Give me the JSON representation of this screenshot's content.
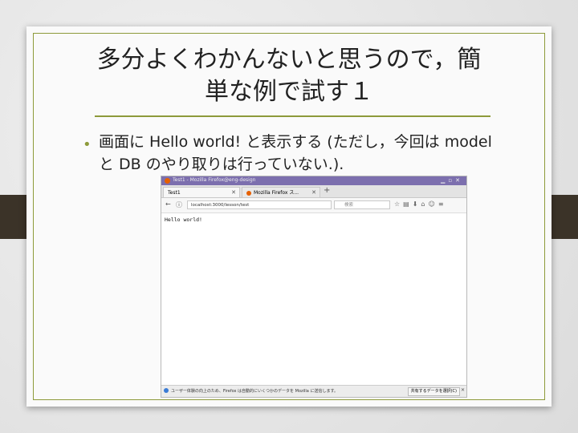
{
  "slide": {
    "title_line1": "多分よくわかんないと思うので，簡",
    "title_line2": "単な例で試す１",
    "bullet": "画面に Hello world! と表示する (ただし，今回は model と DB のやり取りは行っていない.)."
  },
  "browser": {
    "window_title": "Test1 - Mozilla Firefox@eng-design",
    "tabs": [
      {
        "label": "Test1"
      },
      {
        "label": "Mozilla Firefox ス..."
      }
    ],
    "url": "localhost:3000/lesson/test",
    "search_placeholder": "検索",
    "page_text": "Hello world!",
    "notice_text": "ユーザー体験の向上のため、Firefox は自動的にいくつかのデータを Mozilla に送信します。",
    "notice_button": "共有するデータを選択(C)"
  },
  "colors": {
    "accent": "#8d9a3a",
    "titlebar": "#7c6fae",
    "side_tabs": "#3b3328"
  }
}
